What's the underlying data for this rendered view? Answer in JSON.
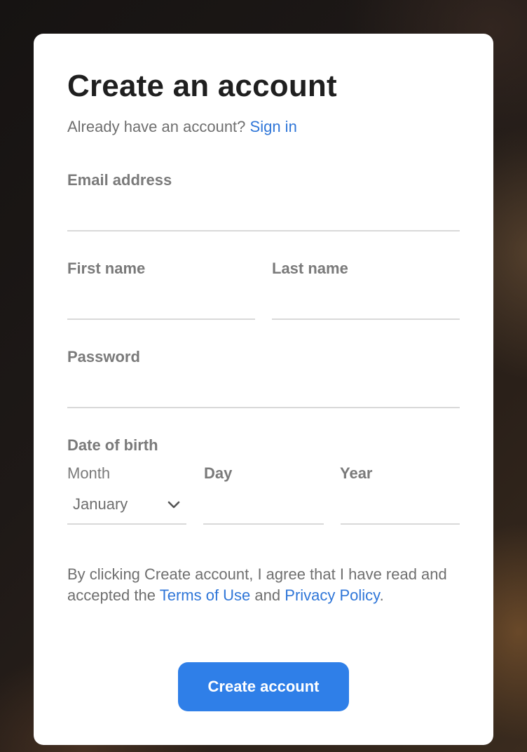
{
  "header": {
    "title": "Create an account",
    "subtitle_prefix": "Already have an account?",
    "signin_link": "Sign in"
  },
  "form": {
    "email": {
      "label": "Email address",
      "value": ""
    },
    "first_name": {
      "label": "First name",
      "value": ""
    },
    "last_name": {
      "label": "Last name",
      "value": ""
    },
    "password": {
      "label": "Password",
      "value": ""
    },
    "dob": {
      "label": "Date of birth",
      "month_label": "Month",
      "month_value": "January",
      "day_label": "Day",
      "day_value": "",
      "year_label": "Year",
      "year_value": ""
    }
  },
  "terms": {
    "text_before": "By clicking Create account, I agree that I have read and accepted the",
    "terms_link": "Terms of Use",
    "and_text": "and",
    "privacy_link": "Privacy Policy",
    "period": "."
  },
  "submit": {
    "label": "Create account"
  },
  "colors": {
    "accent": "#2f7fe8",
    "link": "#2f76d8",
    "card_bg": "#ffffff"
  },
  "icons": {
    "month_select": "chevron-down-icon"
  }
}
